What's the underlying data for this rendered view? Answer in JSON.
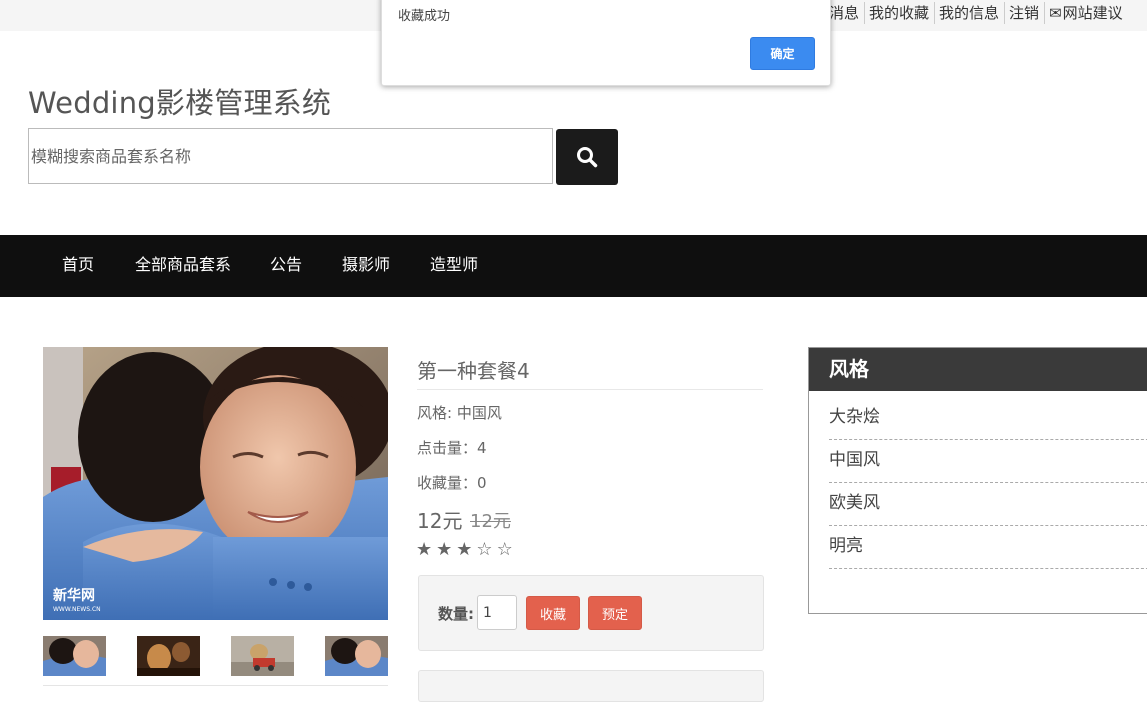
{
  "topbar": {
    "links": [
      "消息",
      "我的收藏",
      "我的信息",
      "注销",
      "网站建议"
    ]
  },
  "header": {
    "title": "Wedding影楼管理系统",
    "search_placeholder": "模糊搜索商品套系名称"
  },
  "nav": {
    "items": [
      "首页",
      "全部商品套系",
      "公告",
      "摄影师",
      "造型师"
    ]
  },
  "product": {
    "watermark": "新华网",
    "watermark_sub": "WWW.NEWS.CN",
    "name": "第一种套餐4",
    "style_line": "风格: 中国风",
    "clicks_line": "点击量：4",
    "favorites_line": "收藏量：0",
    "price": "12元",
    "old_price": "12元",
    "rating": 3,
    "rating_max": 5,
    "qty_label": "数量:",
    "qty_value": "1",
    "favorite_btn": "收藏",
    "reserve_btn": "预定"
  },
  "sidebar": {
    "title": "风格",
    "items": [
      "大杂烩",
      "中国风",
      "欧美风",
      "明亮"
    ]
  },
  "dialog": {
    "message": "收藏成功",
    "ok_label": "确定"
  },
  "colors": {
    "nav_bg": "#0f0f0f",
    "button_red": "#e3614d",
    "dialog_blue": "#3b8bf0",
    "sidebar_header": "#3a3a3a"
  }
}
